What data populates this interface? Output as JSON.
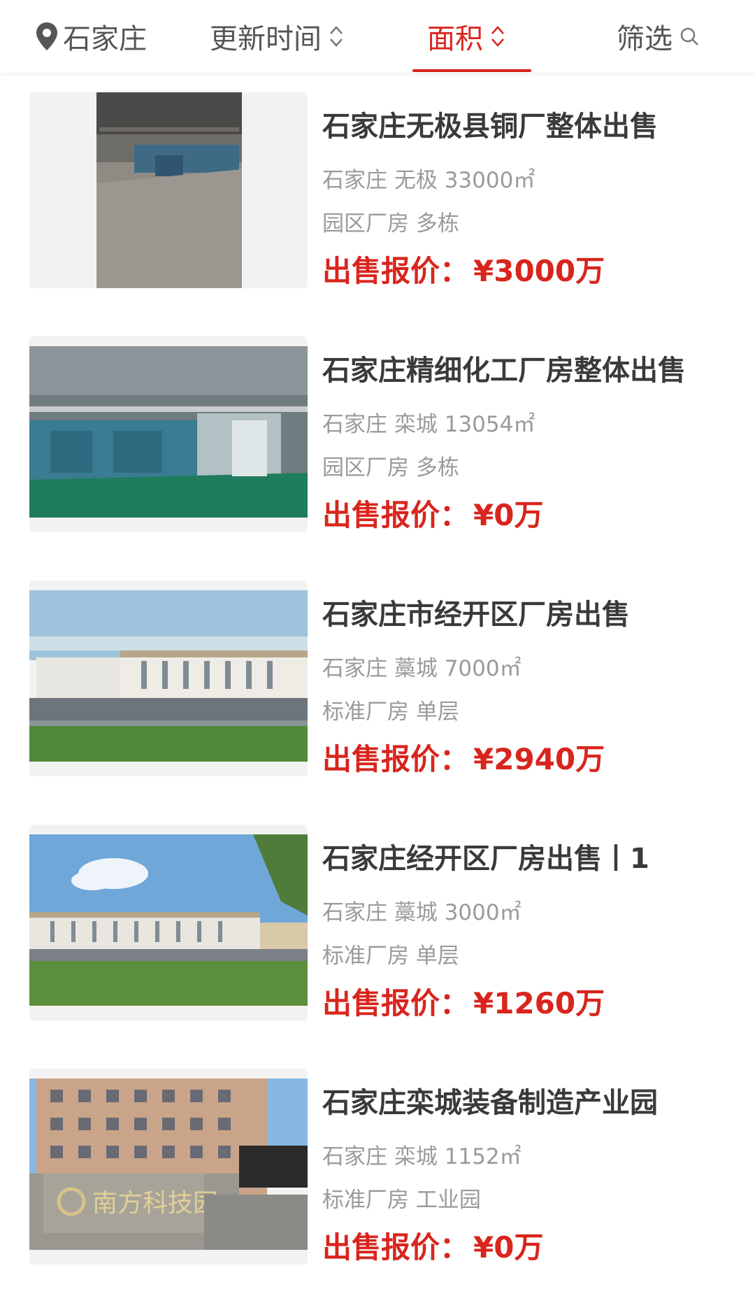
{
  "topbar": {
    "location": {
      "label": "石家庄",
      "icon": "location-pin-icon"
    },
    "sort_time": {
      "label": "更新时间",
      "icon": "sort-arrows-icon"
    },
    "sort_area": {
      "label": "面积",
      "icon": "sort-arrows-icon",
      "active": true
    },
    "filter": {
      "label": "筛选",
      "icon": "search-icon"
    }
  },
  "colors": {
    "accent": "#d8251d",
    "title": "#3a3a3a",
    "meta": "#9a9a9a"
  },
  "listings": [
    {
      "title": "石家庄无极县铜厂整体出售",
      "location": "石家庄 无极 33000㎡",
      "tags": "园区厂房 多栋",
      "price_label": "出售报价：",
      "price_value": "¥3000万",
      "image": "factory-interior-photo"
    },
    {
      "title": "石家庄精细化工厂房整体出售",
      "location": "石家庄 栾城 13054㎡",
      "tags": "园区厂房 多栋",
      "price_label": "出售报价：",
      "price_value": "¥0万",
      "image": "chemical-plant-photo"
    },
    {
      "title": "石家庄市经开区厂房出售",
      "location": "石家庄 藁城 7000㎡",
      "tags": "标准厂房 单层",
      "price_label": "出售报价：",
      "price_value": "¥2940万",
      "image": "industrial-park-rendering"
    },
    {
      "title": "石家庄经开区厂房出售丨1",
      "location": "石家庄 藁城 3000㎡",
      "tags": "标准厂房 单层",
      "price_label": "出售报价：",
      "price_value": "¥1260万",
      "image": "industrial-park-rendering"
    },
    {
      "title": "石家庄栾城装备制造产业园",
      "location": "石家庄 栾城 1152㎡",
      "tags": "标准厂房 工业园",
      "price_label": "出售报价：",
      "price_value": "¥0万",
      "image": "tech-park-building-photo",
      "sign_text": "南方科技园"
    }
  ]
}
